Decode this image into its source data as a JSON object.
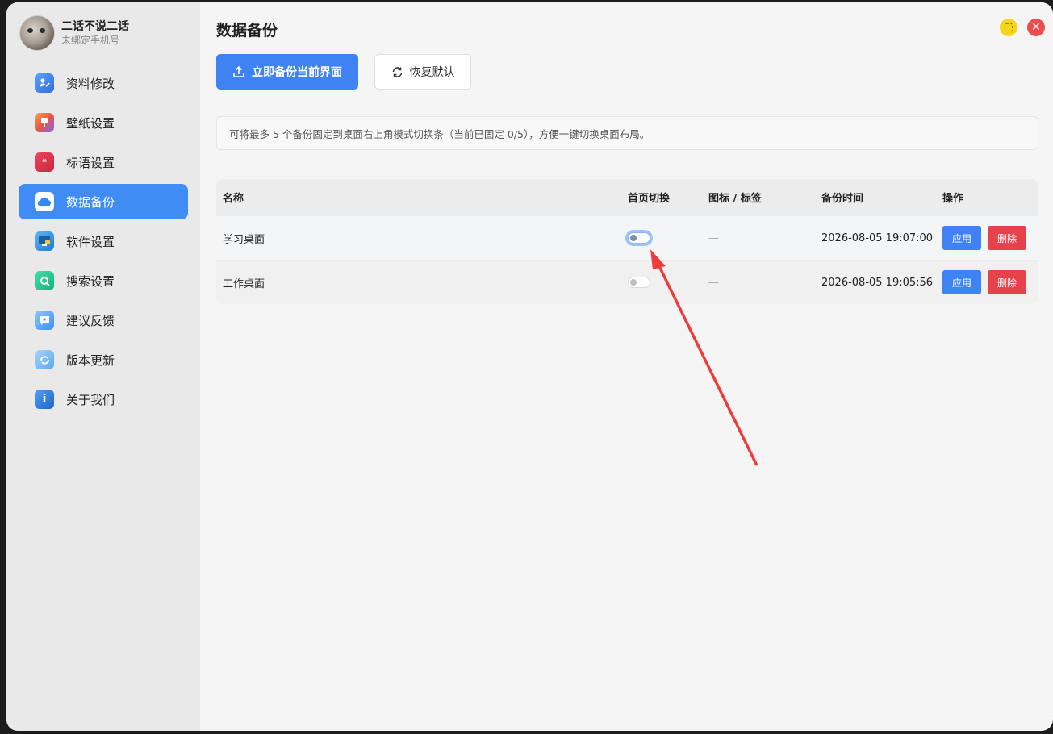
{
  "profile": {
    "name": "二话不说二话",
    "phone_status": "未绑定手机号"
  },
  "sidebar": {
    "items": [
      {
        "label": "资料修改",
        "icon": "profile-edit-icon",
        "color": "#3b7ff0",
        "active": false
      },
      {
        "label": "壁纸设置",
        "icon": "wallpaper-icon",
        "color": "#e6673f",
        "active": false
      },
      {
        "label": "标语设置",
        "icon": "quote-icon",
        "color": "#e23b4f",
        "active": false
      },
      {
        "label": "数据备份",
        "icon": "cloud-icon",
        "color": "#2f8bf0",
        "active": true
      },
      {
        "label": "软件设置",
        "icon": "monitor-icon",
        "color": "#2b8ad8",
        "active": false
      },
      {
        "label": "搜索设置",
        "icon": "search-icon",
        "color": "#22c28e",
        "active": false
      },
      {
        "label": "建议反馈",
        "icon": "feedback-icon",
        "color": "#3d90ef",
        "active": false
      },
      {
        "label": "版本更新",
        "icon": "update-icon",
        "color": "#5aa7ef",
        "active": false
      },
      {
        "label": "关于我们",
        "icon": "info-icon",
        "color": "#2d7fe0",
        "active": false
      }
    ]
  },
  "page": {
    "title": "数据备份",
    "backup_button": "立即备份当前界面",
    "restore_button": "恢复默认",
    "notice": "可将最多 5 个备份固定到桌面右上角模式切换条（当前已固定 0/5），方便一键切换桌面布局。"
  },
  "table": {
    "headers": {
      "name": "名称",
      "toggle": "首页切换",
      "icon": "图标 / 标签",
      "time": "备份时间",
      "ops": "操作"
    },
    "rows": [
      {
        "name": "学习桌面",
        "pinned": false,
        "icon": "—",
        "time": "2026-08-05 19:07:00",
        "apply": "应用",
        "delete": "删除"
      },
      {
        "name": "工作桌面",
        "pinned": false,
        "icon": "—",
        "time": "2026-08-05 19:05:56",
        "apply": "应用",
        "delete": "删除"
      }
    ]
  },
  "colors": {
    "accent": "#3e82f4",
    "danger": "#e5424b",
    "annotation_arrow": "#ee3b3b"
  }
}
